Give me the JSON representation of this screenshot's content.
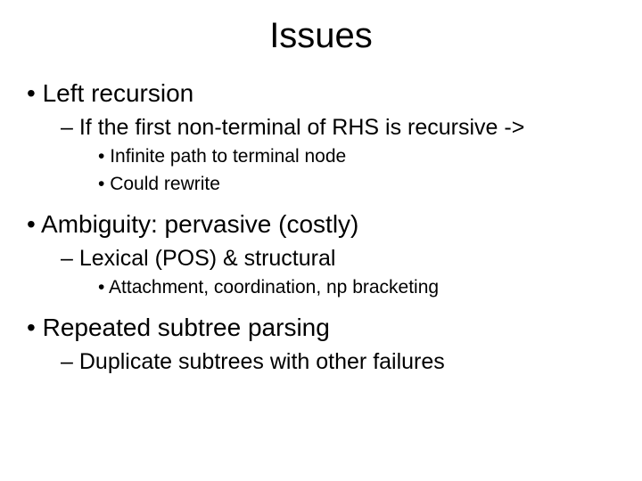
{
  "title": "Issues",
  "items": {
    "l1a": "Left recursion",
    "l2a": "If the first non-terminal of RHS is recursive ->",
    "l3a": "Infinite path to terminal node",
    "l3b": "Could rewrite",
    "l1b": "Ambiguity: pervasive (costly)",
    "l2b": "Lexical (POS) & structural",
    "l3c": "Attachment, coordination, np bracketing",
    "l1c": "Repeated subtree parsing",
    "l2c": "Duplicate subtrees with other failures"
  }
}
